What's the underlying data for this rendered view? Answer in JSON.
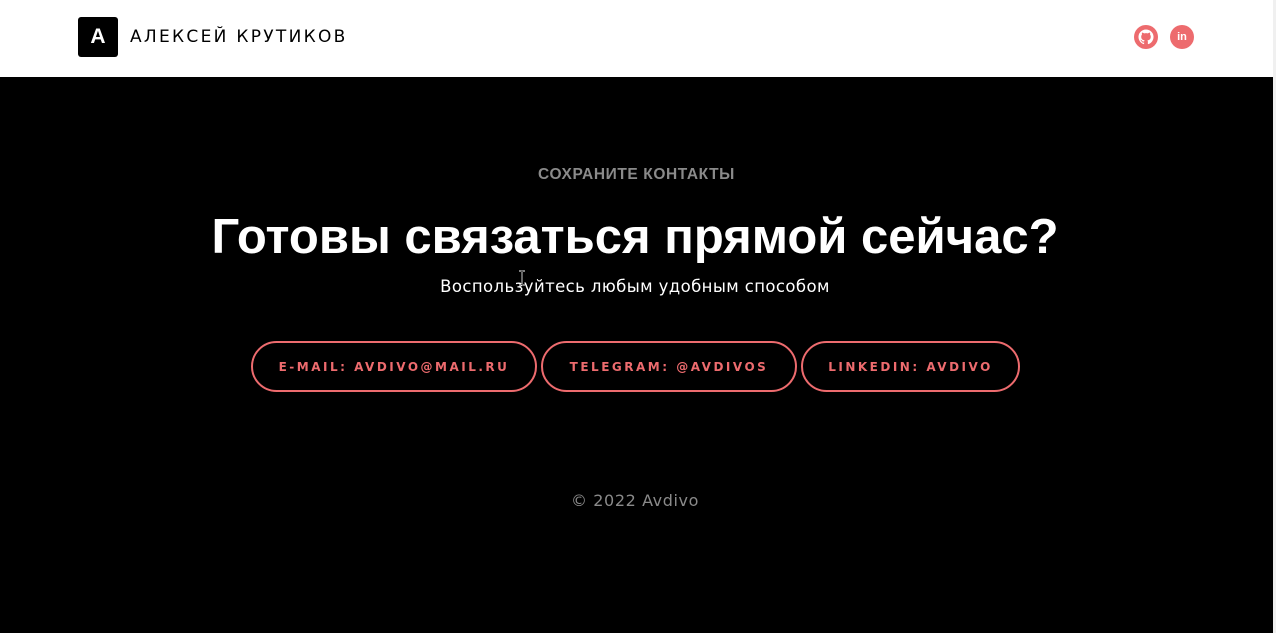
{
  "header": {
    "logo_letter": "А",
    "logo_name": "АЛЕКСЕЙ КРУТИКОВ",
    "socials": [
      {
        "name": "GitHub",
        "icon": "github-icon"
      },
      {
        "name": "LinkedIn",
        "icon": "linkedin-icon",
        "glyph": "in"
      }
    ]
  },
  "contact": {
    "subtitle": "СОХРАНИТЕ КОНТАКТЫ",
    "title": "Готовы связаться прямой сейчас?",
    "lead": "Воспользуйтесь любым удобным способом",
    "buttons": {
      "email": "E-MAIL: AVDIVO@MAIL.RU",
      "telegram": "TELEGRAM: @AVDIVOS",
      "linkedin": "LINKEDIN: AVDIVO"
    }
  },
  "footer": {
    "copyright": "© 2022 Avdivo"
  },
  "colors": {
    "accent": "#ed6b6e",
    "background": "#000000",
    "header_background": "#ffffff",
    "muted_text": "#8a8a8a"
  }
}
